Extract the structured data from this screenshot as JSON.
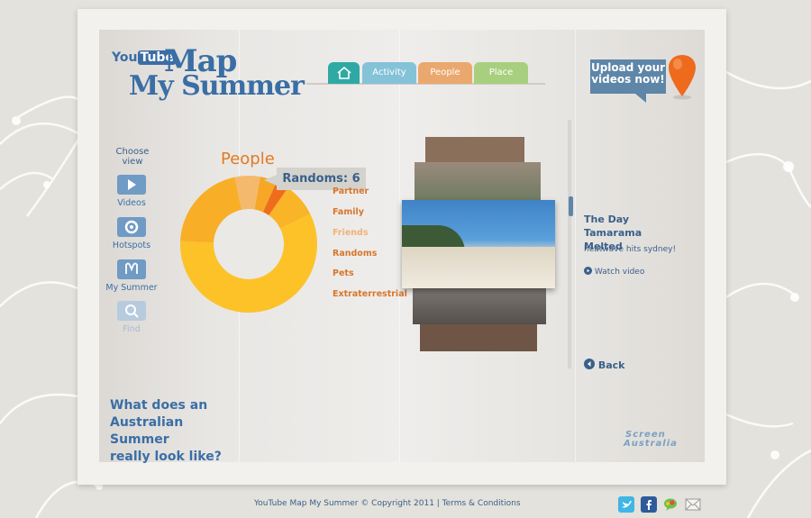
{
  "logo": {
    "youtube": "You",
    "tube": "Tube",
    "map": "Map",
    "summer": "My Summer"
  },
  "tabs": {
    "home": "home",
    "activity": "Activity",
    "people": "People",
    "place": "Place"
  },
  "upload": {
    "line1": "Upload your",
    "line2": "videos now!"
  },
  "sidebar": {
    "choose_line1": "Choose",
    "choose_line2": "view",
    "items": [
      {
        "label": "Videos",
        "icon": "play-icon"
      },
      {
        "label": "Hotspots",
        "icon": "target-icon"
      },
      {
        "label": "My Summer",
        "icon": "my-summer-icon"
      },
      {
        "label": "Find",
        "icon": "search-icon"
      }
    ]
  },
  "chart": {
    "title": "People",
    "tooltip": "Randoms: 6"
  },
  "chart_data": {
    "type": "pie",
    "categories": [
      "Partner",
      "Family",
      "Friends",
      "Randoms",
      "Pets",
      "Extraterrestrial"
    ],
    "values": [
      58,
      4,
      3,
      6,
      8,
      21
    ],
    "colors": [
      "#fcc228",
      "#f6a726",
      "#ee6d1c",
      "#f4b96c",
      "#f9b428",
      "#f8ae27"
    ]
  },
  "legend": [
    "Partner",
    "Family",
    "Friends",
    "Randoms",
    "Pets",
    "Extraterrestrial"
  ],
  "video": {
    "title": "The Day Tamarama Melted",
    "subtitle": "heatwave hits sydney!",
    "watch": "Watch video",
    "back": "Back"
  },
  "headline": {
    "line1": "What does an",
    "line2": "Australian Summer",
    "line3": "really look like?"
  },
  "brand": {
    "line1": "Screen",
    "line2": "Australia"
  },
  "footer": {
    "text": "YouTube Map My Summer © Copyright 2011  |  Terms & Conditions"
  },
  "colors": {
    "accent": "#3a6ea5",
    "orange": "#e27a23"
  }
}
